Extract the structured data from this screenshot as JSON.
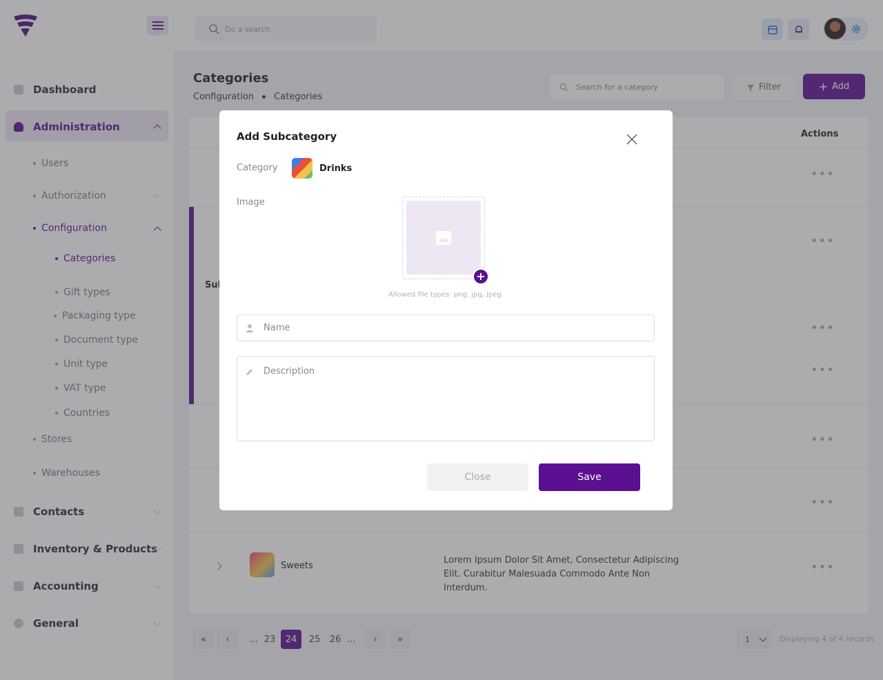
{
  "sidebar": {
    "items": [
      {
        "label": "Dashboard"
      },
      {
        "label": "Administration"
      },
      {
        "label": "Contacts"
      },
      {
        "label": "Inventory & Products"
      },
      {
        "label": "Accounting"
      },
      {
        "label": "General"
      }
    ],
    "admin_sub": [
      {
        "label": "Users"
      },
      {
        "label": "Authorization"
      },
      {
        "label": "Configuration"
      },
      {
        "label": "Stores"
      },
      {
        "label": "Warehouses"
      }
    ],
    "config_sub": [
      {
        "label": "Categories"
      },
      {
        "label": "Gift types"
      },
      {
        "label": "Packaging type"
      },
      {
        "label": "Document type"
      },
      {
        "label": "Unit type"
      },
      {
        "label": "VAT type"
      },
      {
        "label": "Countries"
      }
    ]
  },
  "topbar": {
    "search_placeholder": "Do a search"
  },
  "page": {
    "title": "Categories",
    "breadcrumb": [
      "Configuration",
      "Categories"
    ],
    "search_placeholder": "Search for a category",
    "filter_label": "Filter",
    "add_label": "Add",
    "actions_header": "Actions",
    "sub_label": "Sub",
    "row_name": "Sweets",
    "row_description": "Lorem Ipsum Dolor Sit Amet, Consectetur Adipiscing Elit. Curabitur Malesuada Commodo Ante Non Interdum.",
    "more_glyph": "•••"
  },
  "pagination": {
    "ellipsis": "...",
    "pages": [
      "23",
      "24",
      "25",
      "26"
    ],
    "active": "24",
    "per_page": "1",
    "records": "Displaying 4 of 4 records"
  },
  "modal": {
    "title": "Add Subcategory",
    "category_label": "Category",
    "category_value": "Drinks",
    "image_label": "Image",
    "file_hint": "Allowed file types: png, jpg, jpeg.",
    "name_placeholder": "Name",
    "description_placeholder": "Description",
    "close_label": "Close",
    "save_label": "Save"
  },
  "colors": {
    "accent": "#5a1090",
    "overlay": "#46464b"
  }
}
